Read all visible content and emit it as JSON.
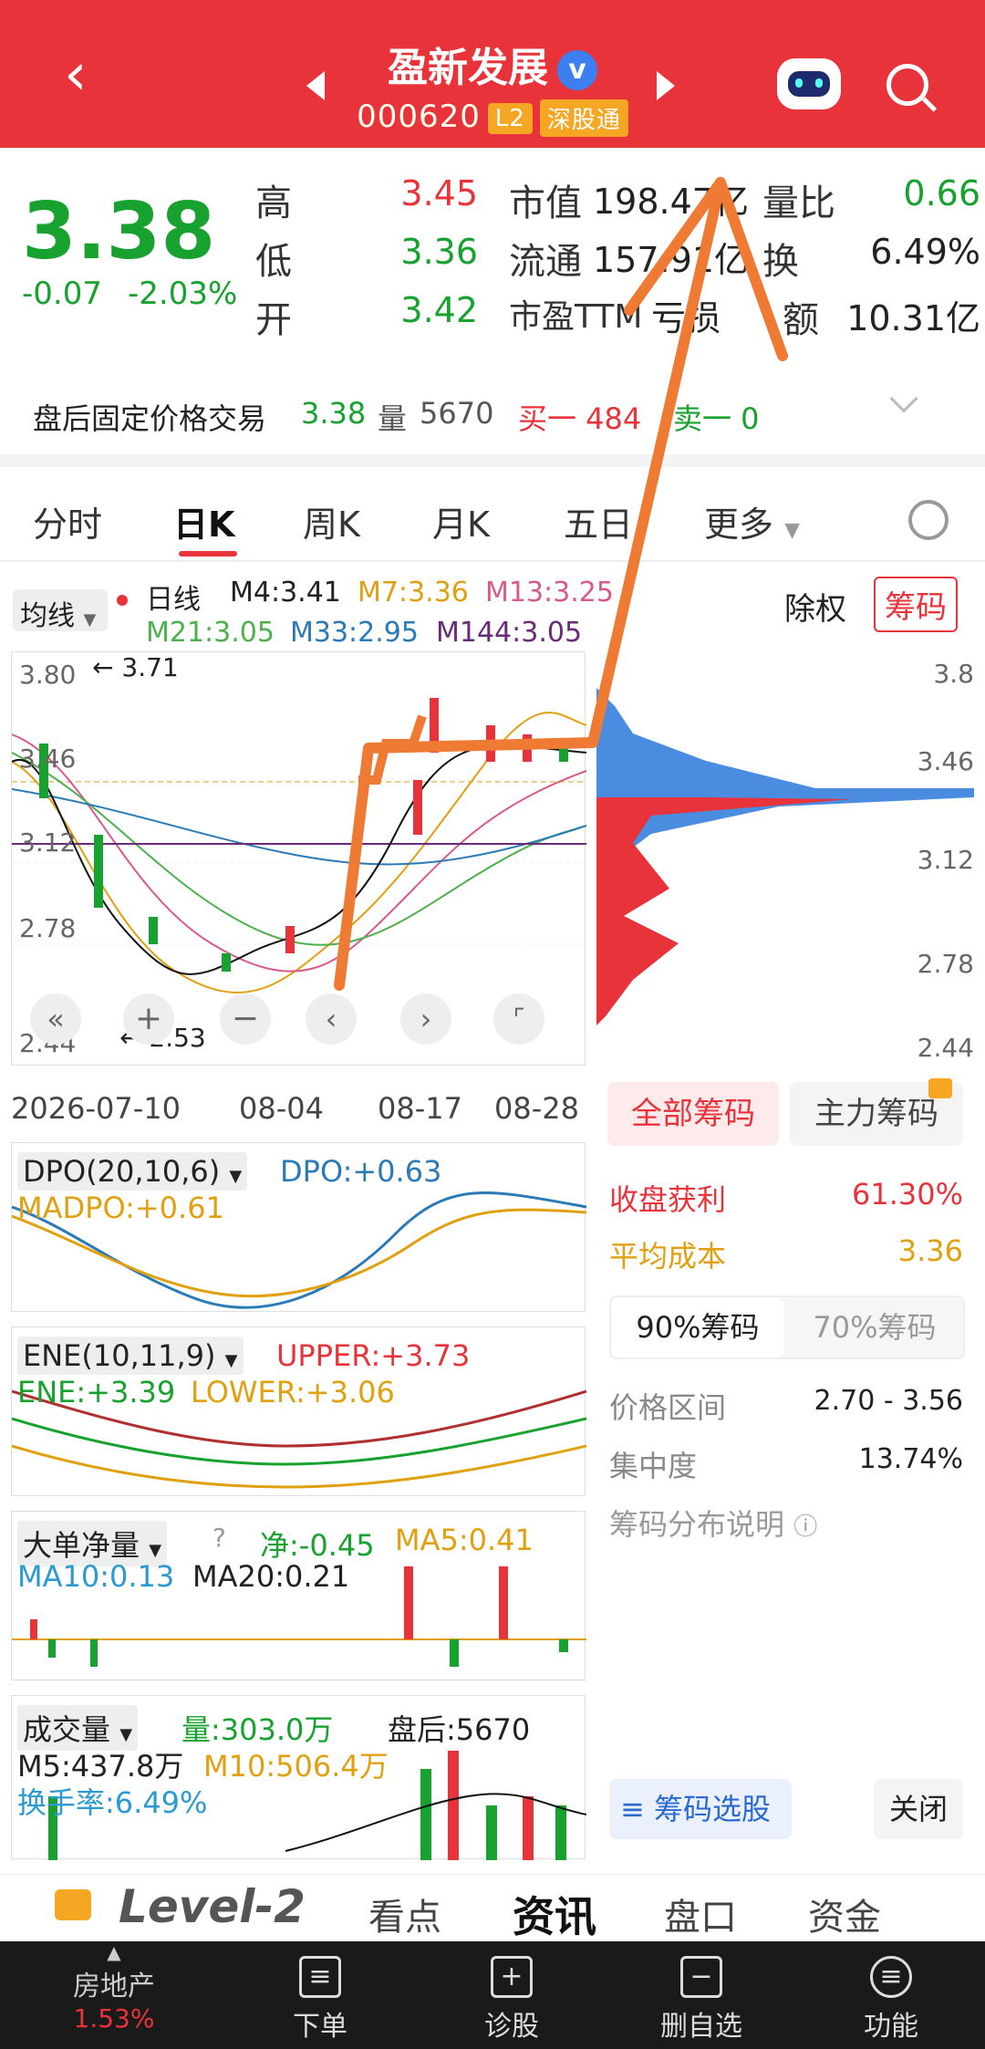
{
  "header": {
    "title": "盈新发展",
    "verified": "v",
    "code": "000620",
    "tag_l2": "L2",
    "tag_sgt": "深股通"
  },
  "quote": {
    "price": "3.38",
    "change": "-0.07",
    "change_pct": "-2.03%",
    "high_lbl": "高",
    "high": "3.45",
    "low_lbl": "低",
    "low": "3.36",
    "open_lbl": "开",
    "open": "3.42",
    "mcap_lbl": "市值",
    "mcap": "198.47亿",
    "float_lbl": "流通",
    "float": "157.91亿",
    "pe_lbl": "市盈TTM",
    "pe": "亏损",
    "vr_lbl": "量比",
    "vr": "0.66",
    "turn_lbl": "换",
    "turn": "6.49%",
    "amt_lbl": "额",
    "amt": "10.31亿"
  },
  "after": {
    "label": "盘后固定价格交易",
    "price": "3.38",
    "vol_lbl": "量",
    "vol": "5670",
    "buy": "买一 484",
    "sell": "卖一 0"
  },
  "tabs": [
    "分时",
    "日K",
    "周K",
    "月K",
    "五日",
    "更多"
  ],
  "ma": {
    "sel": "均线",
    "daily": "日线",
    "m4": "M4:3.41",
    "m7": "M7:3.36",
    "m13": "M13:3.25",
    "m21": "M21:3.05",
    "m33": "M33:2.95",
    "m144": "M144:3.05"
  },
  "chart": {
    "btn_fq": "除权",
    "btn_cm": "筹码",
    "y1": "3.80",
    "y2": "3.46",
    "y3": "3.12",
    "y4": "2.78",
    "y5": "2.44",
    "hi": "3.71",
    "lo": "2.53",
    "d1": "2026-07-10",
    "d2": "08-04",
    "d3": "08-17",
    "d4": "08-28",
    "ry1": "3.8",
    "ry2": "3.46",
    "ry3": "3.12",
    "ry4": "2.78",
    "ry5": "2.44"
  },
  "chips": {
    "tab1": "全部筹码",
    "tab2": "主力筹码",
    "profit_lbl": "收盘获利",
    "profit": "61.30%",
    "cost_lbl": "平均成本",
    "cost": "3.36",
    "t90": "90%筹码",
    "t70": "70%筹码",
    "range_lbl": "价格区间",
    "range": "2.70 - 3.56",
    "conc_lbl": "集中度",
    "conc": "13.74%",
    "explain": "筹码分布说明",
    "select": "筹码选股",
    "close": "关闭"
  },
  "dpo": {
    "name": "DPO(20,10,6)",
    "dpo": "DPO:+0.63",
    "madpo": "MADPO:+0.61"
  },
  "ene": {
    "name": "ENE(10,11,9)",
    "upper": "UPPER:+3.73",
    "ene": "ENE:+3.39",
    "lower": "LOWER:+3.06"
  },
  "big": {
    "name": "大单净量",
    "net": "净:-0.45",
    "ma5": "MA5:0.41",
    "ma10": "MA10:0.13",
    "ma20": "MA20:0.21"
  },
  "vol": {
    "name": "成交量",
    "vol": "量:303.0万",
    "after": "盘后:5670",
    "m5": "M5:437.8万",
    "m10": "M10:506.4万",
    "turn": "换手率:6.49%"
  },
  "level2": {
    "brand": "Level-2",
    "t1": "看点",
    "t2": "资讯",
    "t3": "盘口",
    "t4": "资金"
  },
  "bottom": {
    "sector": "房地产",
    "sector_pct": "1.53%",
    "b1": "下单",
    "b2": "诊股",
    "b3": "删自选",
    "b4": "功能"
  }
}
